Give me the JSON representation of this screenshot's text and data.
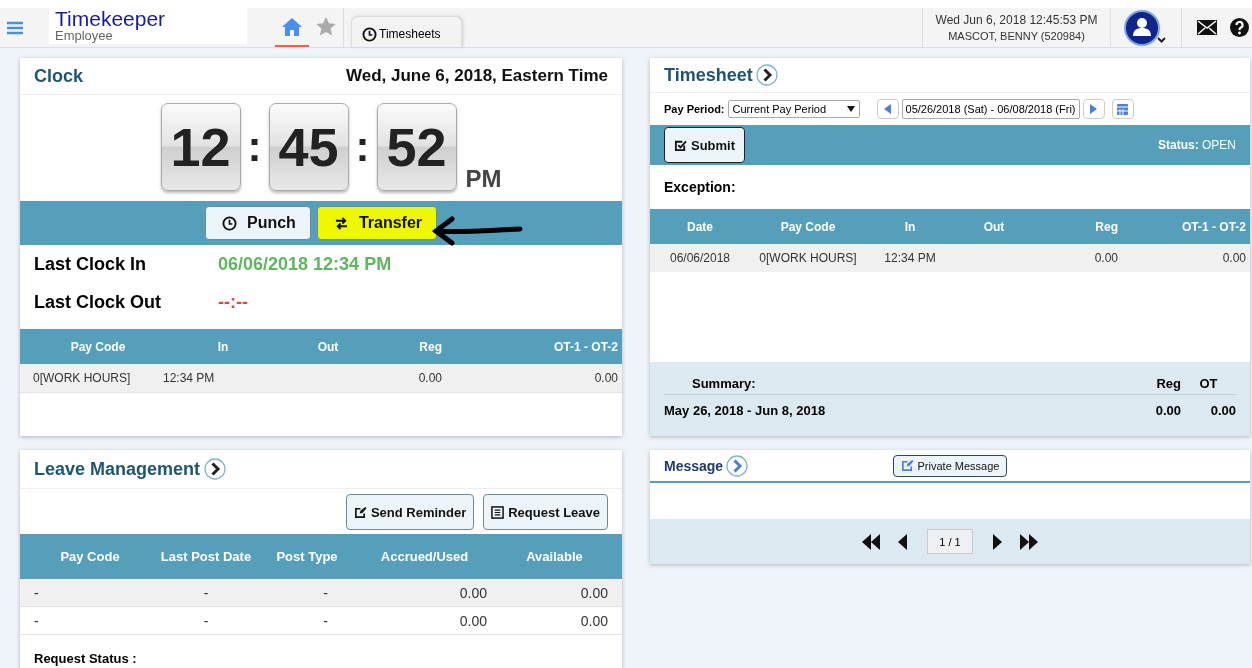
{
  "header": {
    "app_title": "Timekeeper",
    "app_subtitle": "Employee",
    "nav": [
      {
        "kind": "home",
        "selected": true
      },
      {
        "kind": "star",
        "selected": false
      }
    ],
    "tabs": [
      {
        "label": "Timesheets",
        "selected": false
      }
    ],
    "datetime": "Wed Jun 6, 2018 12:45:53 PM",
    "user": "MASCOT, BENNY (520984)"
  },
  "clock": {
    "title": "Clock",
    "date": "Wed, June 6, 2018, Eastern Time",
    "digits": [
      "12",
      "45",
      "52"
    ],
    "separators": [
      ":",
      ":"
    ],
    "meridiem": "PM",
    "buttons": [
      {
        "kind": "punch",
        "label": "Punch",
        "highlighted": false
      },
      {
        "kind": "transfer",
        "label": "Transfer",
        "highlighted": true
      }
    ],
    "last_clock_in_label": "Last Clock In",
    "last_clock_in": "06/06/2018 12:34 PM",
    "last_clock_out_label": "Last Clock Out",
    "last_clock_out": "--:--",
    "table": {
      "columns": [
        "Pay Code",
        "In",
        "Out",
        "Reg",
        "OT-1 - OT-2"
      ],
      "rows": [
        [
          "0[WORK HOURS]",
          "12:34 PM",
          "",
          "0.00",
          "0.00"
        ]
      ]
    }
  },
  "leave": {
    "title": "Leave Management",
    "buttons": [
      {
        "kind": "reminder",
        "label": "Send Reminder"
      },
      {
        "kind": "request",
        "label": "Request Leave"
      }
    ],
    "table": {
      "columns": [
        "Pay Code",
        "Last Post Date",
        "Post Type",
        "Accrued/Used",
        "Available"
      ],
      "rows": [
        [
          "-",
          "-",
          "-",
          "0.00",
          "0.00"
        ],
        [
          "-",
          "-",
          "-",
          "0.00",
          "0.00"
        ]
      ]
    },
    "request_status": "Request Status :"
  },
  "timesheet": {
    "title": "Timesheet",
    "pay_period_label": "Pay Period:",
    "pay_period": "Current Pay Period",
    "date_range": "05/26/2018 (Sat) - 06/08/2018 (Fri)",
    "submit": "Submit",
    "status": "**Status:** OPEN",
    "exception": "Exception:",
    "table": {
      "columns": [
        "Date",
        "Pay Code",
        "In",
        "Out",
        "Reg",
        "OT-1 - OT-2"
      ],
      "rows": [
        [
          "06/06/2018",
          "0[WORK HOURS]",
          "12:34 PM",
          "",
          "0.00",
          "0.00"
        ]
      ]
    },
    "summary": {
      "label": "Summary:",
      "columns": [
        "Reg",
        "OT"
      ],
      "period": "May 26, 2018 - Jun 8, 2018",
      "values": [
        "0.00",
        "0.00"
      ]
    }
  },
  "message": {
    "title": "Message",
    "button": "Private Message",
    "page": "1 / 1"
  }
}
